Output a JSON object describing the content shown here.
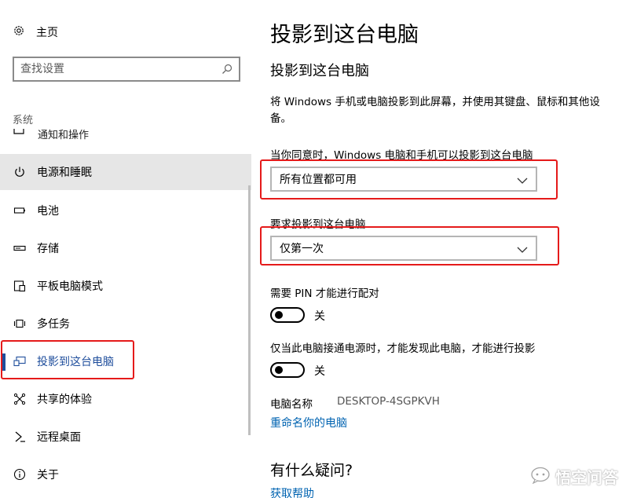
{
  "sidebar": {
    "home_label": "主页",
    "search_placeholder": "查找设置",
    "section_label": "系统",
    "cut_item_label": "通知和操作",
    "items": [
      {
        "label": "电源和睡眠",
        "icon": "power-icon"
      },
      {
        "label": "电池",
        "icon": "battery-icon"
      },
      {
        "label": "存储",
        "icon": "storage-icon"
      },
      {
        "label": "平板电脑模式",
        "icon": "tablet-mode-icon"
      },
      {
        "label": "多任务",
        "icon": "multitasking-icon"
      },
      {
        "label": "投影到这台电脑",
        "icon": "project-to-pc-icon",
        "selected": true
      },
      {
        "label": "共享的体验",
        "icon": "shared-experiences-icon"
      },
      {
        "label": "远程桌面",
        "icon": "remote-desktop-icon"
      },
      {
        "label": "关于",
        "icon": "info-icon"
      }
    ]
  },
  "main": {
    "page_title": "投影到这台电脑",
    "sub_title": "投影到这台电脑",
    "description": "将 Windows 手机或电脑投影到此屏幕，并使用其键盘、鼠标和其他设备。",
    "availability_label": "当你同意时，Windows 电脑和手机可以投影到这台电脑",
    "availability_value": "所有位置都可用",
    "ask_label": "要求投影到这台电脑",
    "ask_value": "仅第一次",
    "pin_label": "需要 PIN 才能进行配对",
    "pin_state": "关",
    "power_label": "仅当此电脑接通电源时，才能发现此电脑，才能进行投影",
    "power_state": "关",
    "pc_name_label": "电脑名称",
    "pc_name_value": "DESKTOP-4SGPKVH",
    "rename_link": "重命名你的电脑",
    "question_title": "有什么疑问?",
    "help_link": "获取帮助"
  },
  "watermark": {
    "text": "悟空问答"
  },
  "colors": {
    "accent": "#1f4e9c",
    "link": "#0063b1",
    "highlight_box": "#e51a1a",
    "hover_bg": "#e6e6e6"
  }
}
